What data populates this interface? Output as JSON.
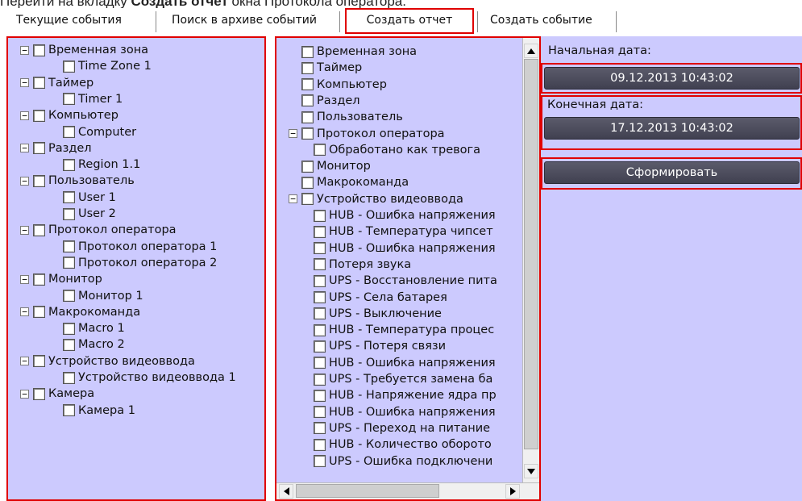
{
  "caption": {
    "prefix": "Перейти на вкладку ",
    "bold": "Создать отчет",
    "suffix": " окна Протокола оператора."
  },
  "tabs": [
    {
      "label": "Текущие события"
    },
    {
      "label": "Поиск в архиве событий"
    },
    {
      "label": "Создать отчет"
    },
    {
      "label": "Создать событие"
    }
  ],
  "left_tree": [
    {
      "label": "Временная зона",
      "level": 0,
      "expander": "−"
    },
    {
      "label": "Time Zone 1",
      "level": 1
    },
    {
      "label": "Таймер",
      "level": 0,
      "expander": "−"
    },
    {
      "label": "Timer 1",
      "level": 1
    },
    {
      "label": "Компьютер",
      "level": 0,
      "expander": "−"
    },
    {
      "label": "Computer",
      "level": 1
    },
    {
      "label": "Раздел",
      "level": 0,
      "expander": "−"
    },
    {
      "label": "Region 1.1",
      "level": 1
    },
    {
      "label": "Пользователь",
      "level": 0,
      "expander": "−"
    },
    {
      "label": "User 1",
      "level": 1
    },
    {
      "label": "User 2",
      "level": 1
    },
    {
      "label": "Протокол оператора",
      "level": 0,
      "expander": "−"
    },
    {
      "label": "Протокол оператора 1",
      "level": 1
    },
    {
      "label": "Протокол оператора 2",
      "level": 1
    },
    {
      "label": "Монитор",
      "level": 0,
      "expander": "−"
    },
    {
      "label": "Монитор 1",
      "level": 1
    },
    {
      "label": "Макрокоманда",
      "level": 0,
      "expander": "−"
    },
    {
      "label": "Macro 1",
      "level": 1
    },
    {
      "label": "Macro 2",
      "level": 1
    },
    {
      "label": "Устройство видеоввода",
      "level": 0,
      "expander": "−"
    },
    {
      "label": "Устройство видеоввода 1",
      "level": 1
    },
    {
      "label": "Камера",
      "level": 0,
      "expander": "−"
    },
    {
      "label": "Камера 1",
      "level": 1
    }
  ],
  "middle_tree": [
    {
      "label": "Временная зона",
      "level": 0
    },
    {
      "label": "Таймер",
      "level": 0
    },
    {
      "label": "Компьютер",
      "level": 0
    },
    {
      "label": "Раздел",
      "level": 0
    },
    {
      "label": "Пользователь",
      "level": 0
    },
    {
      "label": "Протокол оператора",
      "level": 0,
      "expander": "−"
    },
    {
      "label": "Обработано как тревога",
      "level": 1
    },
    {
      "label": "Монитор",
      "level": 0
    },
    {
      "label": "Макрокоманда",
      "level": 0
    },
    {
      "label": "Устройство видеоввода",
      "level": 0,
      "expander": "−"
    },
    {
      "label": "HUB - Ошибка напряжения",
      "level": 1
    },
    {
      "label": "HUB - Температура чипсет",
      "level": 1
    },
    {
      "label": "HUB - Ошибка напряжения",
      "level": 1
    },
    {
      "label": "Потеря звука",
      "level": 1
    },
    {
      "label": "UPS - Восстановление пита",
      "level": 1
    },
    {
      "label": "UPS - Села батарея",
      "level": 1
    },
    {
      "label": "UPS - Выключение",
      "level": 1
    },
    {
      "label": "HUB - Температура процес",
      "level": 1
    },
    {
      "label": "UPS - Потеря связи",
      "level": 1
    },
    {
      "label": "HUB - Ошибка напряжения",
      "level": 1
    },
    {
      "label": "UPS - Требуется замена ба",
      "level": 1
    },
    {
      "label": "HUB - Напряжение ядра пр",
      "level": 1
    },
    {
      "label": "HUB - Ошибка напряжения",
      "level": 1
    },
    {
      "label": "UPS - Переход на питание",
      "level": 1
    },
    {
      "label": "HUB - Количество оборото",
      "level": 1
    },
    {
      "label": "UPS - Ошибка подключени",
      "level": 1
    }
  ],
  "right": {
    "start_label": "Начальная дата:",
    "start_value": "09.12.2013 10:43:02",
    "end_label": "Конечная дата:",
    "end_value": "17.12.2013 10:43:02",
    "generate_label": "Сформировать"
  }
}
